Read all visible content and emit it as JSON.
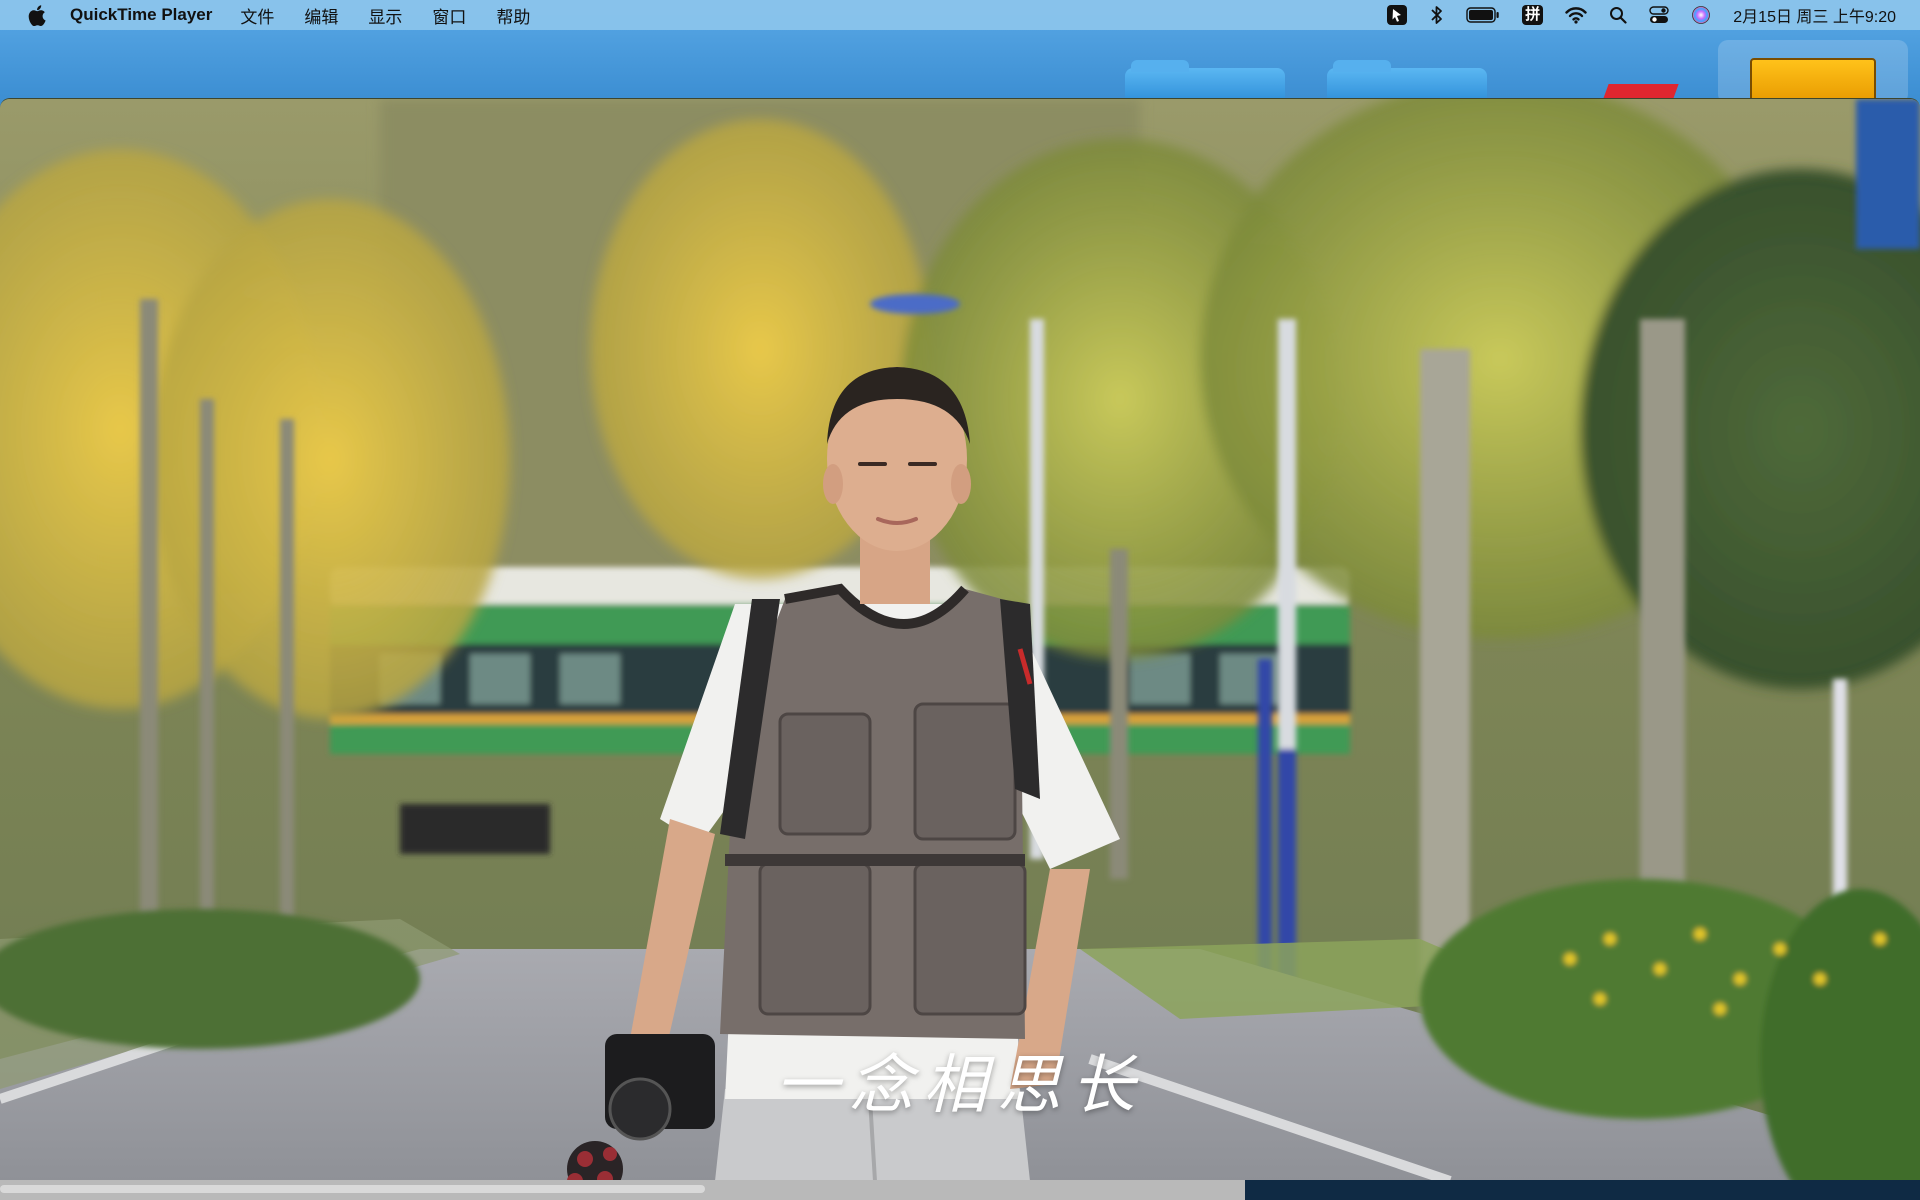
{
  "menubar": {
    "app_name": "QuickTime Player",
    "menus": [
      "文件",
      "编辑",
      "显示",
      "窗口",
      "帮助"
    ],
    "input_method": "拼",
    "clock": "2月15日 周三 上午9:20"
  },
  "video": {
    "subtitle": "一念相思长"
  }
}
